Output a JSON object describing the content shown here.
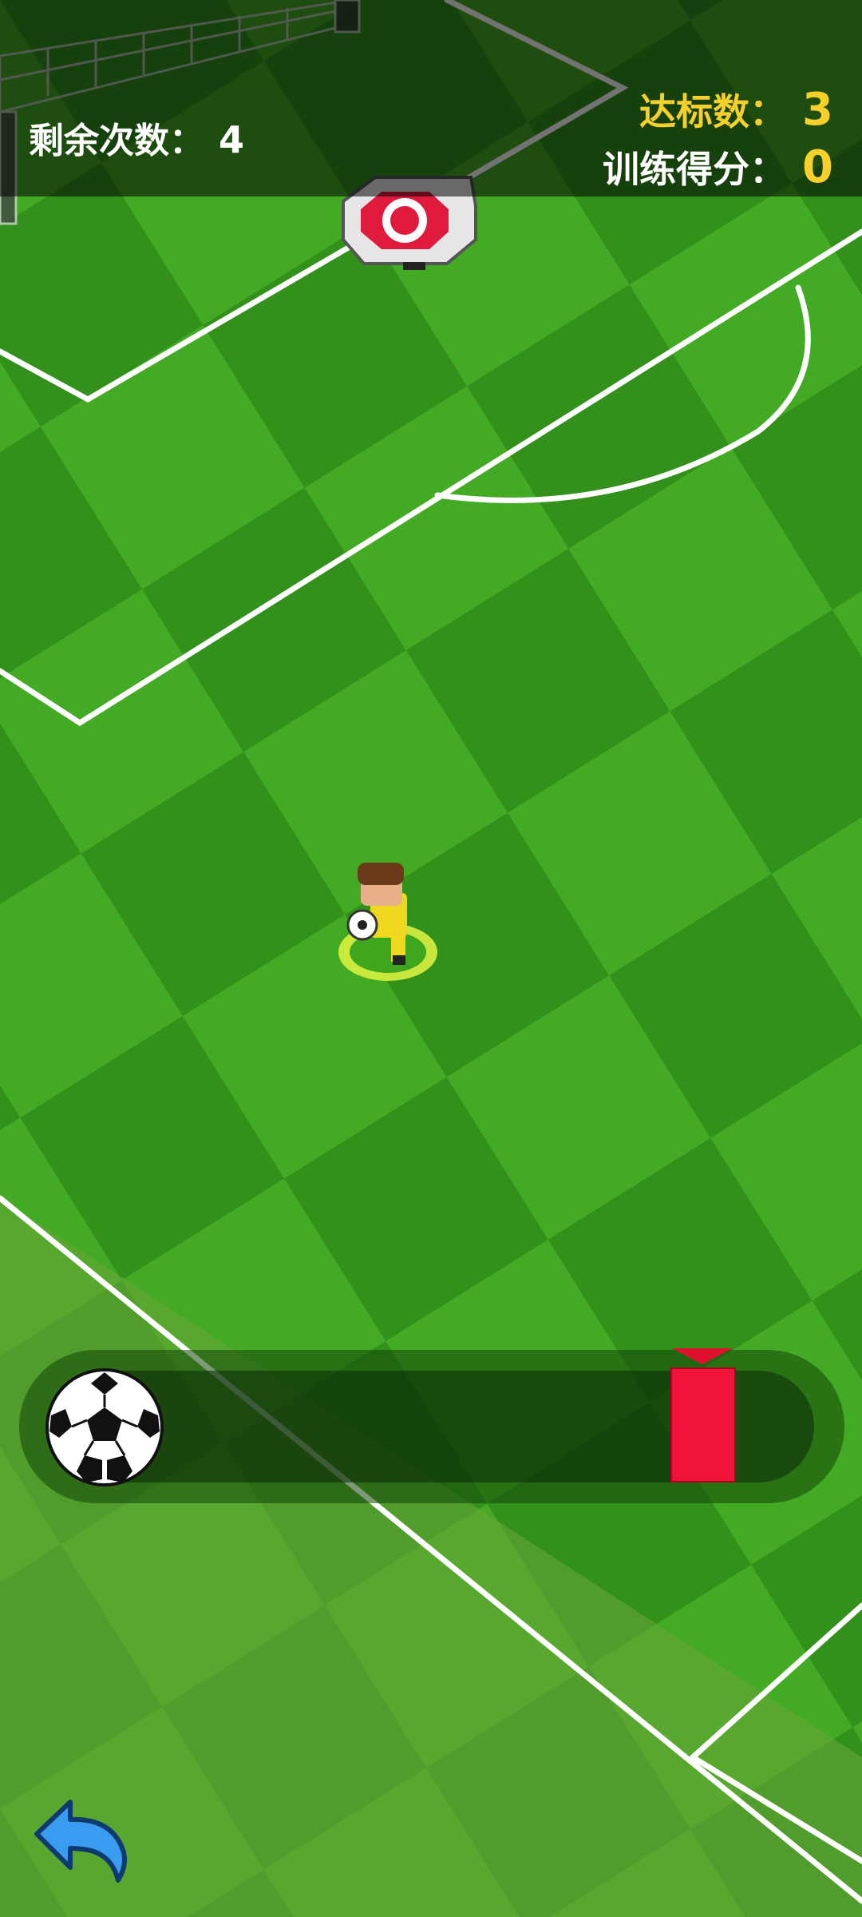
{
  "hud": {
    "remaining_label": "剩余次数：",
    "remaining_value": "4",
    "target_label": "达标数：",
    "target_value": "3",
    "score_label": "训练得分：",
    "score_value": "0"
  },
  "power_meter": {
    "ball_icon": "soccer-ball-icon",
    "marker_icon": "power-marker-icon"
  },
  "controls": {
    "back_icon": "back-arrow-icon"
  },
  "colors": {
    "grass_light": "#4cb428",
    "grass_dark": "#2f8a1a",
    "target_yellow": "#f5cf2b",
    "marker_red": "#f0143a",
    "back_blue": "#3a9cf0"
  }
}
